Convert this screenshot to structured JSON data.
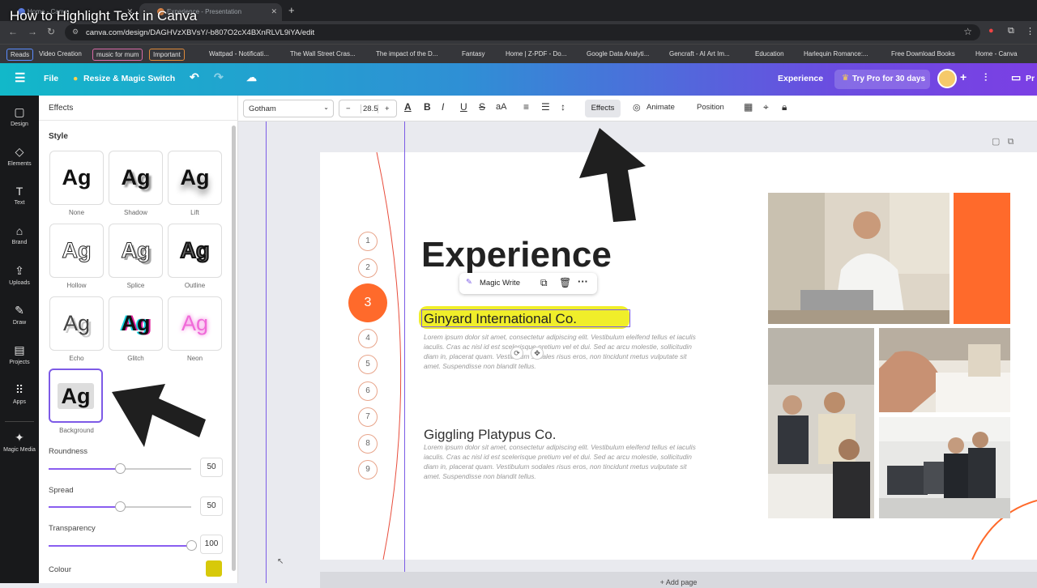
{
  "video_title": "How to Highlight Text in Canva",
  "browser": {
    "tabs": [
      {
        "label": "Home - Canva"
      },
      {
        "label": "Experience - Presentation"
      }
    ],
    "url": "canva.com/design/DAGHVzXBVsY/-b807O2cX4BXnRLVL9iYA/edit",
    "bookmarks": [
      "Reads",
      "Video Creation",
      "music for mum",
      "Important",
      "Wattpad - Notificati...",
      "The Wall Street Cras...",
      "The impact of the D...",
      "Fantasy",
      "Home | Z-PDF - Do...",
      "Google Data Analyti...",
      "Gencraft - AI Art Im...",
      "Education",
      "Harlequin Romance:...",
      "Free Download Books",
      "Home - Canva"
    ]
  },
  "header": {
    "file": "File",
    "resize": "Resize & Magic Switch",
    "doc_title": "Experience",
    "pro": "Try Pro for 30 days",
    "present": "Pr"
  },
  "rail": [
    "Design",
    "Elements",
    "Text",
    "Brand",
    "Uploads",
    "Draw",
    "Projects",
    "Apps",
    "Magic Media"
  ],
  "panel": {
    "title": "Effects",
    "style_label": "Style",
    "styles": [
      {
        "sample": "Ag",
        "label": "None"
      },
      {
        "sample": "Ag",
        "label": "Shadow"
      },
      {
        "sample": "Ag",
        "label": "Lift"
      },
      {
        "sample": "Ag",
        "label": "Hollow"
      },
      {
        "sample": "Ag",
        "label": "Splice"
      },
      {
        "sample": "Ag",
        "label": "Outline"
      },
      {
        "sample": "Ag",
        "label": "Echo"
      },
      {
        "sample": "Ag",
        "label": "Glitch"
      },
      {
        "sample": "Ag",
        "label": "Neon"
      },
      {
        "sample": "Ag",
        "label": "Background"
      }
    ],
    "sliders": [
      {
        "label": "Roundness",
        "value": "50",
        "fraction": 0.5
      },
      {
        "label": "Spread",
        "value": "50",
        "fraction": 0.5
      },
      {
        "label": "Transparency",
        "value": "100",
        "fraction": 1.0
      }
    ],
    "colour_label": "Colour",
    "colour_value": "#d7c90a"
  },
  "toolbar": {
    "font": "Gotham",
    "minus": "−",
    "size": "28.5",
    "plus": "+",
    "effects": "Effects",
    "animate": "Animate",
    "position": "Position"
  },
  "slide": {
    "numbers": [
      "1",
      "2",
      "3",
      "4",
      "5",
      "6",
      "7",
      "8",
      "9"
    ],
    "title": "Experience",
    "magic_write": "Magic Write",
    "company1": "Ginyard International Co.",
    "company2": "Giggling Platypus Co.",
    "lorem": "Lorem ipsum dolor sit amet, consectetur adipiscing elit. Vestibulum eleifend tellus et iaculis iaculis. Cras ac nisl id est scelerisque pretium vel et dui. Sed ac arcu molestie, sollicitudin diam in, placerat quam. Vestibulum sodales risus eros, non tincidunt metus vulputate sit amet. Suspendisse non blandit tellus."
  },
  "add_page": "+ Add page",
  "colors": {
    "accent": "#ff6a2b",
    "highlight": "#f0ee2a",
    "selection": "#7b5ce6"
  }
}
